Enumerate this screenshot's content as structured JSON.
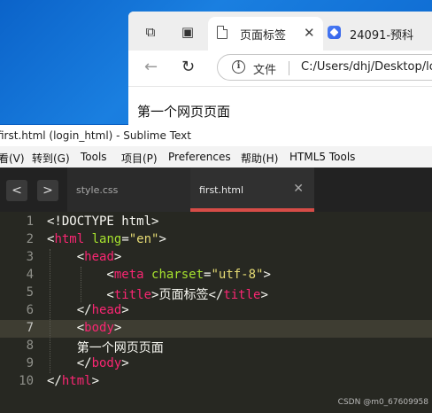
{
  "browser": {
    "tab1_title": "页面标签",
    "tab2_title": "24091-预科",
    "tab_close_glyph": "✕",
    "address_file_label": "文件",
    "address_url": "C:/Users/dhj/Desktop/lo",
    "page_text": "第一个网页页面"
  },
  "sublime": {
    "title": "first.html (login_html) - Sublime Text",
    "menu": [
      "看(V)",
      "转到(G)",
      "Tools",
      "项目(P)",
      "Preferences",
      "帮助(H)",
      "HTML5 Tools"
    ],
    "tabs": [
      {
        "label": "style.css",
        "active": false
      },
      {
        "label": "first.html",
        "active": true
      }
    ],
    "tab_close_glyph": "✕",
    "highlighted_line": 7,
    "lines": [
      {
        "n": "1",
        "segments": [
          {
            "t": "<!DOCTYPE html>",
            "c": "#f8f8f2"
          }
        ]
      },
      {
        "n": "2",
        "segments": [
          {
            "t": "<",
            "c": "#f8f8f2"
          },
          {
            "t": "html",
            "c": "#f92672"
          },
          {
            "t": " ",
            "c": "#f8f8f2"
          },
          {
            "t": "lang",
            "c": "#a6e22e"
          },
          {
            "t": "=",
            "c": "#f8f8f2"
          },
          {
            "t": "\"en\"",
            "c": "#e6db74"
          },
          {
            "t": ">",
            "c": "#f8f8f2"
          }
        ]
      },
      {
        "n": "3",
        "segments": [
          {
            "t": "    <",
            "c": "#f8f8f2"
          },
          {
            "t": "head",
            "c": "#f92672"
          },
          {
            "t": ">",
            "c": "#f8f8f2"
          }
        ]
      },
      {
        "n": "4",
        "segments": [
          {
            "t": "        <",
            "c": "#f8f8f2"
          },
          {
            "t": "meta",
            "c": "#f92672"
          },
          {
            "t": " ",
            "c": "#f8f8f2"
          },
          {
            "t": "charset",
            "c": "#a6e22e"
          },
          {
            "t": "=",
            "c": "#f8f8f2"
          },
          {
            "t": "\"utf-8\"",
            "c": "#e6db74"
          },
          {
            "t": ">",
            "c": "#f8f8f2"
          }
        ]
      },
      {
        "n": "5",
        "segments": [
          {
            "t": "        <",
            "c": "#f8f8f2"
          },
          {
            "t": "title",
            "c": "#f92672"
          },
          {
            "t": ">页面标签</",
            "c": "#f8f8f2"
          },
          {
            "t": "title",
            "c": "#f92672"
          },
          {
            "t": ">",
            "c": "#f8f8f2"
          }
        ]
      },
      {
        "n": "6",
        "segments": [
          {
            "t": "    </",
            "c": "#f8f8f2"
          },
          {
            "t": "head",
            "c": "#f92672"
          },
          {
            "t": ">",
            "c": "#f8f8f2"
          }
        ]
      },
      {
        "n": "7",
        "segments": [
          {
            "t": "    <",
            "c": "#f8f8f2"
          },
          {
            "t": "body",
            "c": "#f92672"
          },
          {
            "t": ">",
            "c": "#f8f8f2"
          }
        ]
      },
      {
        "n": "8",
        "segments": [
          {
            "t": "    第一个网页页面",
            "c": "#f8f8f2"
          }
        ]
      },
      {
        "n": "9",
        "segments": [
          {
            "t": "    </",
            "c": "#f8f8f2"
          },
          {
            "t": "body",
            "c": "#f92672"
          },
          {
            "t": ">",
            "c": "#f8f8f2"
          }
        ]
      },
      {
        "n": "10",
        "segments": [
          {
            "t": "</",
            "c": "#f8f8f2"
          },
          {
            "t": "html",
            "c": "#f92672"
          },
          {
            "t": ">",
            "c": "#f8f8f2"
          }
        ]
      }
    ]
  },
  "watermark": "CSDN @m0_67609958"
}
